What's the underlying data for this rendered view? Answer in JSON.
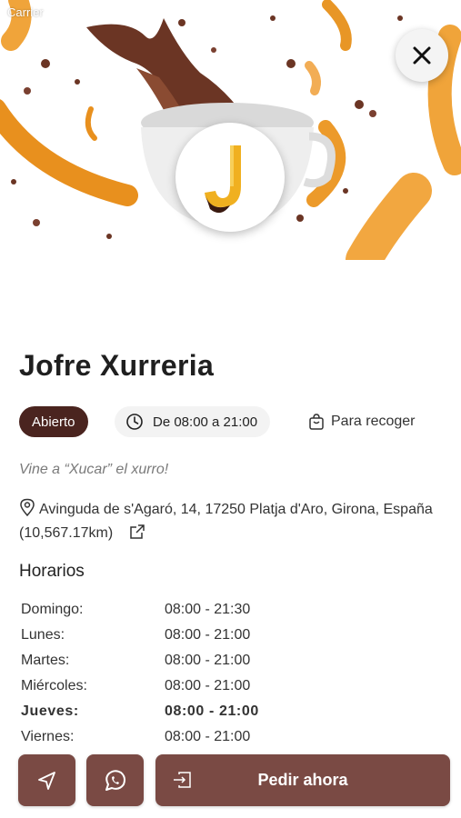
{
  "status_bar": {
    "carrier": "Carrier"
  },
  "store": {
    "name": "Jofre Xurreria",
    "status": "Abierto",
    "hours_today": "De 08:00 a 21:00",
    "service": "Para recoger",
    "tagline": "Vine a “Xucar” el xurro!",
    "address": "Avinguda de s'Agaró, 14, 17250 Platja d'Aro, Girona, España (10,567.17km)"
  },
  "schedule": {
    "title": "Horarios",
    "rows": [
      {
        "day": "Domingo:",
        "hours": "08:00 - 21:30"
      },
      {
        "day": "Lunes:",
        "hours": "08:00 - 21:00"
      },
      {
        "day": "Martes:",
        "hours": "08:00 - 21:00"
      },
      {
        "day": "Miércoles:",
        "hours": "08:00 - 21:00"
      },
      {
        "day": "Jueves:",
        "hours": "08:00 - 21:00"
      },
      {
        "day": "Viernes:",
        "hours": "08:00 - 21:00"
      }
    ]
  },
  "actions": {
    "order_label": "Pedir ahora"
  },
  "icons": {
    "close": "close-icon",
    "clock": "clock-icon",
    "bag": "shopping-bag-icon",
    "pin": "location-pin-icon",
    "external": "external-link-icon",
    "navigate": "navigation-arrow-icon",
    "whatsapp": "whatsapp-icon",
    "order": "enter-icon"
  },
  "colors": {
    "badge": "#4a241f",
    "button": "#7a4a44",
    "churro": "#e8901e",
    "chocolate": "#5a2a1a"
  }
}
